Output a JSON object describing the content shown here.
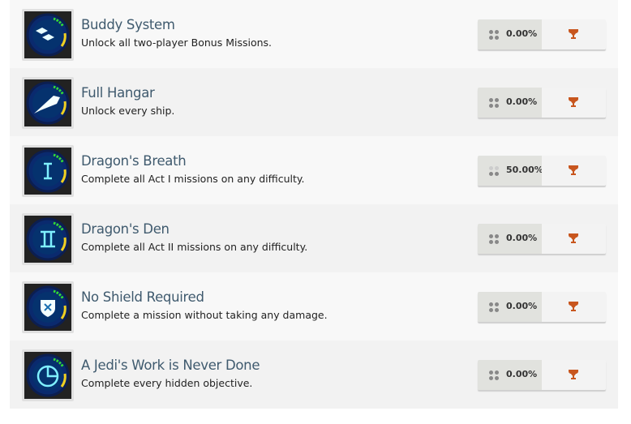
{
  "colors": {
    "title": "#3f5a6e",
    "trophy": "#c8561e",
    "ring": "#0a2a6e",
    "glow": "#7ff0ff",
    "green": "#33dd33",
    "yellow": "#f0d020"
  },
  "achievements": [
    {
      "title": "Buddy System",
      "description": "Unlock all two-player Bonus Missions.",
      "percent": "0.00%",
      "icon": "buddy-system-icon",
      "glyph": "tiles",
      "progress": 0
    },
    {
      "title": "Full Hangar",
      "description": "Unlock every ship.",
      "percent": "0.00%",
      "icon": "ship-icon",
      "glyph": "ship",
      "progress": 0
    },
    {
      "title": "Dragon's Breath",
      "description": "Complete all Act I missions on any difficulty.",
      "percent": "50.00%",
      "icon": "act-one-icon",
      "glyph": "I",
      "progress": 50
    },
    {
      "title": "Dragon's Den",
      "description": "Complete all Act II missions on any difficulty.",
      "percent": "0.00%",
      "icon": "act-two-icon",
      "glyph": "II",
      "progress": 0
    },
    {
      "title": "No Shield Required",
      "description": "Complete a mission without taking any damage.",
      "percent": "0.00%",
      "icon": "shield-icon",
      "glyph": "shield",
      "progress": 0
    },
    {
      "title": "A Jedi's Work is Never Done",
      "description": "Complete every hidden objective.",
      "percent": "0.00%",
      "icon": "pie-clock-icon",
      "glyph": "pie",
      "progress": 0
    }
  ]
}
